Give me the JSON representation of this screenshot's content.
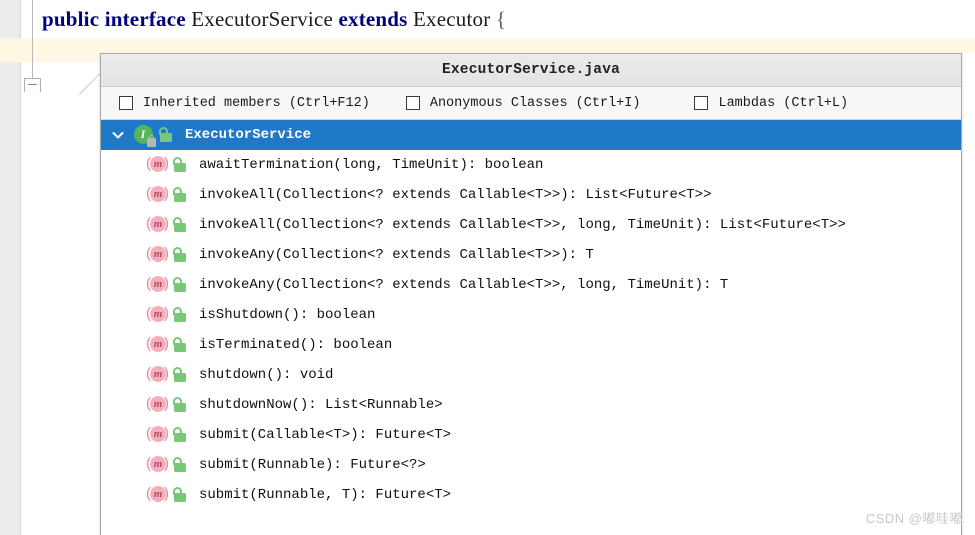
{
  "editor": {
    "code_line": {
      "tokens": [
        {
          "text": "public",
          "type": "keyword"
        },
        {
          "text": " ",
          "type": "plain"
        },
        {
          "text": "interface",
          "type": "keyword"
        },
        {
          "text": " ",
          "type": "plain"
        },
        {
          "text": "ExecutorService",
          "type": "plain"
        },
        {
          "text": " ",
          "type": "plain"
        },
        {
          "text": "extends",
          "type": "keyword"
        },
        {
          "text": " ",
          "type": "plain"
        },
        {
          "text": "Executor",
          "type": "plain"
        },
        {
          "text": " ",
          "type": "plain"
        },
        {
          "text": "{",
          "type": "brace"
        }
      ],
      "keyword_public": "public",
      "keyword_interface": "interface",
      "type_name": "ExecutorService",
      "keyword_extends": "extends",
      "super_type": "Executor",
      "open_brace": "{"
    },
    "fold_marker": "collapse-fold",
    "colors": {
      "keyword": "#000080",
      "identifier": "#1b1b1b",
      "caret_row_highlight": "#fdf9e4",
      "gutter": "#ececec"
    }
  },
  "popup": {
    "title": "ExecutorService.java",
    "filters": [
      {
        "label": "Inherited members (Ctrl+F12)",
        "checked": false,
        "name": "inherited-members"
      },
      {
        "label": "Anonymous Classes (Ctrl+I)",
        "checked": false,
        "name": "anonymous-classes"
      },
      {
        "label": "Lambdas (Ctrl+L)",
        "checked": false,
        "name": "lambdas"
      }
    ],
    "selection_color": "#2079c8",
    "tree": {
      "root": {
        "label": "ExecutorService",
        "icon": "interface-icon",
        "visibility_icon": "public-lock-icon",
        "expanded": true,
        "selected": true
      },
      "members": [
        {
          "label": "awaitTermination(long, TimeUnit): boolean",
          "icon": "method-icon",
          "visibility_icon": "public-lock-icon"
        },
        {
          "label": "invokeAll(Collection<? extends Callable<T>>): List<Future<T>>",
          "icon": "method-icon",
          "visibility_icon": "public-lock-icon"
        },
        {
          "label": "invokeAll(Collection<? extends Callable<T>>, long, TimeUnit): List<Future<T>>",
          "icon": "method-icon",
          "visibility_icon": "public-lock-icon"
        },
        {
          "label": "invokeAny(Collection<? extends Callable<T>>): T",
          "icon": "method-icon",
          "visibility_icon": "public-lock-icon"
        },
        {
          "label": "invokeAny(Collection<? extends Callable<T>>, long, TimeUnit): T",
          "icon": "method-icon",
          "visibility_icon": "public-lock-icon"
        },
        {
          "label": "isShutdown(): boolean",
          "icon": "method-icon",
          "visibility_icon": "public-lock-icon"
        },
        {
          "label": "isTerminated(): boolean",
          "icon": "method-icon",
          "visibility_icon": "public-lock-icon"
        },
        {
          "label": "shutdown(): void",
          "icon": "method-icon",
          "visibility_icon": "public-lock-icon"
        },
        {
          "label": "shutdownNow(): List<Runnable>",
          "icon": "method-icon",
          "visibility_icon": "public-lock-icon"
        },
        {
          "label": "submit(Callable<T>): Future<T>",
          "icon": "method-icon",
          "visibility_icon": "public-lock-icon"
        },
        {
          "label": "submit(Runnable): Future<?>",
          "icon": "method-icon",
          "visibility_icon": "public-lock-icon"
        },
        {
          "label": "submit(Runnable, T): Future<T>",
          "icon": "method-icon",
          "visibility_icon": "public-lock-icon"
        }
      ]
    }
  },
  "watermark": {
    "text": "CSDN @嘟哇嘟"
  }
}
